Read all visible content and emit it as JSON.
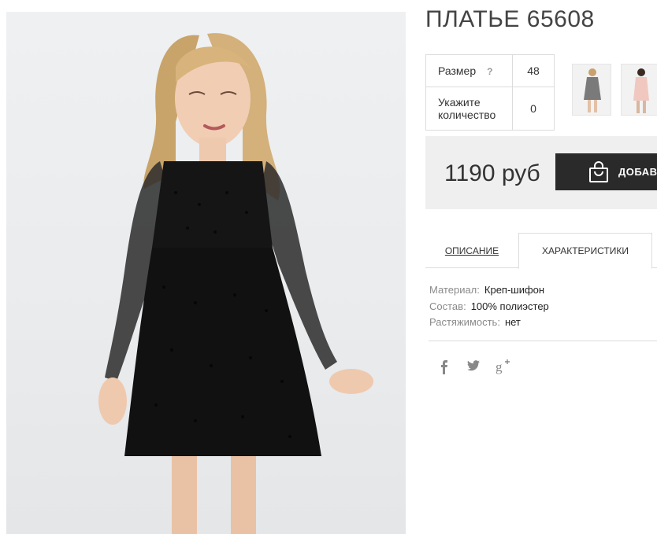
{
  "product": {
    "title": "ПЛАТЬЕ 65608"
  },
  "options": {
    "size_label": "Размер",
    "size_help": "?",
    "size_value": "48",
    "qty_label": "Укажите количество",
    "qty_value": "0"
  },
  "price": {
    "amount": "1190 руб",
    "buy_label": "ДОБАВИ"
  },
  "tabs": [
    {
      "label": "ОПИСАНИЕ",
      "active": false
    },
    {
      "label": "ХАРАКТЕРИСТИКИ",
      "active": true
    }
  ],
  "characteristics": [
    {
      "key": "Материал:",
      "value": "Креп-шифон"
    },
    {
      "key": "Состав:",
      "value": "100% полиэстер"
    },
    {
      "key": "Растяжимость:",
      "value": "нет"
    }
  ],
  "social": [
    {
      "name": "facebook-icon",
      "glyph": "f"
    },
    {
      "name": "twitter-icon",
      "glyph": "🐦"
    },
    {
      "name": "google-plus-icon",
      "glyph": "g+"
    }
  ],
  "colors": {
    "button_bg": "#2a2a2a",
    "price_bg": "#efefef"
  }
}
